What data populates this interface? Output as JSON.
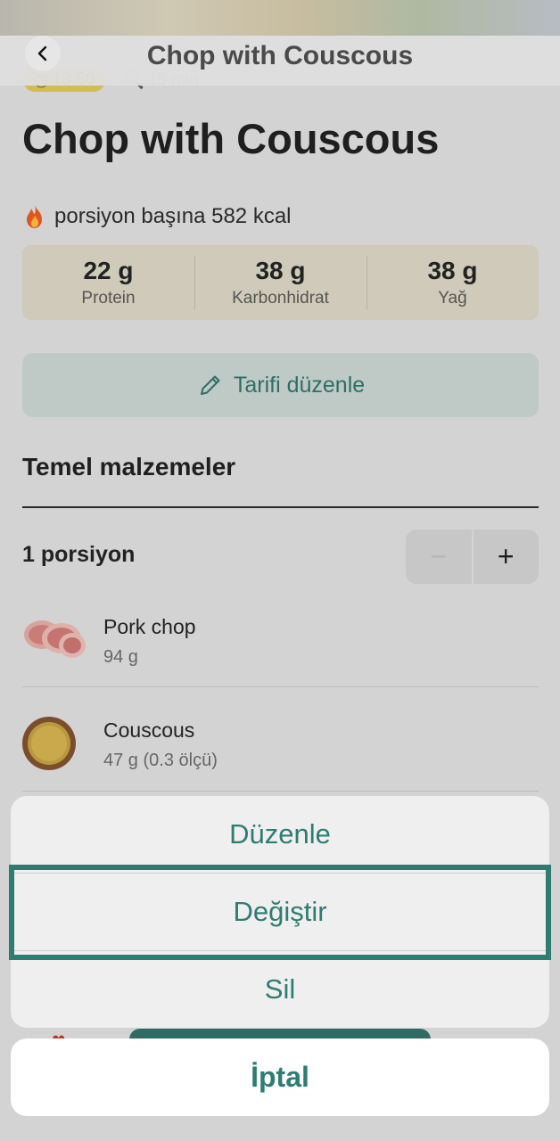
{
  "nav": {
    "title": "Chop with Couscous",
    "back_icon": "chevron-left-icon"
  },
  "meta": {
    "time": "13:50",
    "duration": "15 min"
  },
  "recipe": {
    "title": "Chop with Couscous"
  },
  "nutrition": {
    "kcal_text": "porsiyon başına 582 kcal",
    "macros": [
      {
        "value": "22 g",
        "label": "Protein"
      },
      {
        "value": "38 g",
        "label": "Karbonhidrat"
      },
      {
        "value": "38 g",
        "label": "Yağ"
      }
    ]
  },
  "edit_recipe": {
    "label": "Tarifi düzenle"
  },
  "ingredients_section": {
    "heading": "Temel malzemeler",
    "portion_label": "1 porsiyon",
    "minus": "−",
    "plus": "+",
    "items": [
      {
        "name": "Pork chop",
        "qty": "94 g"
      },
      {
        "name": "Couscous",
        "qty": "47 g (0.3 ölçü)"
      }
    ]
  },
  "action_sheet": {
    "items": [
      "Düzenle",
      "Değiştir",
      "Sil"
    ],
    "highlighted": "Değiştir",
    "cancel": "İptal"
  },
  "colors": {
    "accent": "#2f7c72",
    "macro_bg": "#cfcab9",
    "time_badge": "#d4bd4f"
  }
}
